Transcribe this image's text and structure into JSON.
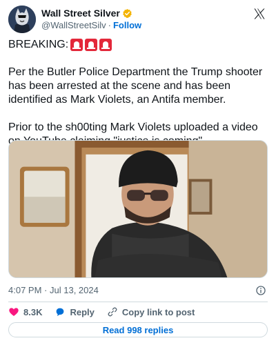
{
  "author": {
    "display_name": "Wall Street Silver",
    "handle": "@WallStreetSilv",
    "separator": "·",
    "follow_label": "Follow",
    "avatar_icon": "wolf-avatar-icon",
    "verified_color": "#f4b400"
  },
  "tweet": {
    "breaking_label": "BREAKING:",
    "emoji": [
      "police-siren",
      "police-siren",
      "police-siren"
    ],
    "paragraph_1": "Per the Butler Police Department the Trump shooter has been arrested at the scene and has been identified as Mark Violets, an Antifa member.",
    "paragraph_2": "Prior to the sh00ting Mark Violets uploaded a video on YouTube claiming \"justice is coming\"."
  },
  "media": {
    "description_icon": "video-thumbnail"
  },
  "meta": {
    "time": "4:07 PM",
    "separator": "·",
    "date": "Jul 13, 2024"
  },
  "actions": {
    "likes": "8.3K",
    "reply_label": "Reply",
    "copy_label": "Copy link to post"
  },
  "replies": {
    "label": "Read 998 replies"
  },
  "colors": {
    "link": "#006fd6",
    "like": "#f91880",
    "secondary_text": "#536471"
  }
}
